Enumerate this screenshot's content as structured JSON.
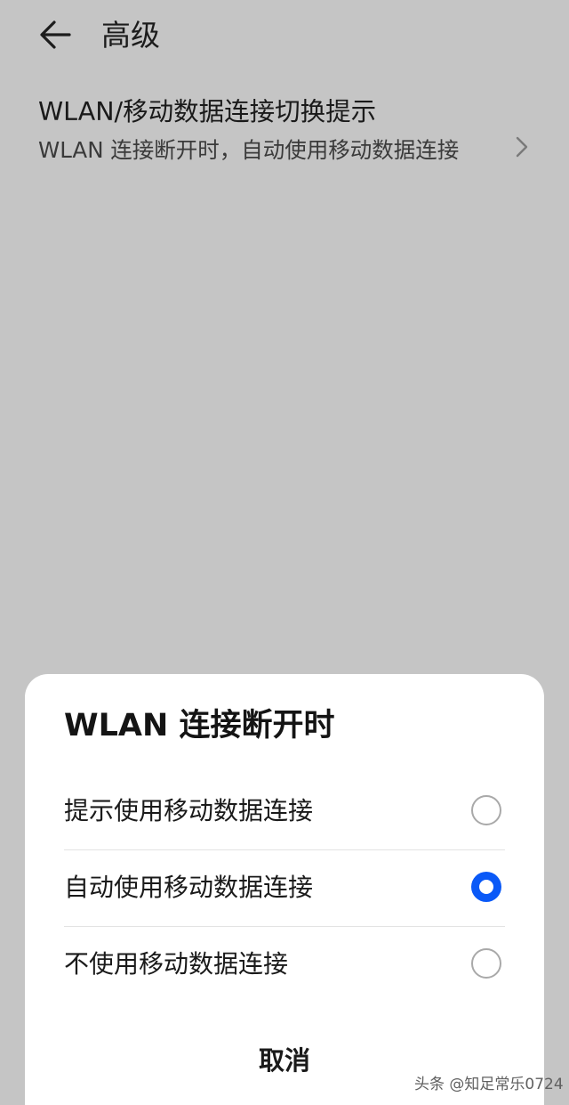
{
  "header": {
    "back_icon": "arrow-left-icon",
    "title": "高级"
  },
  "setting": {
    "title": "WLAN/移动数据连接切换提示",
    "description": "WLAN 连接断开时，自动使用移动数据连接",
    "chevron_icon": "chevron-right-icon"
  },
  "dialog": {
    "title": "WLAN 连接断开时",
    "options": [
      {
        "label": "提示使用移动数据连接",
        "selected": false
      },
      {
        "label": "自动使用移动数据连接",
        "selected": true
      },
      {
        "label": "不使用移动数据连接",
        "selected": false
      }
    ],
    "cancel_label": "取消"
  },
  "watermark": "头条 @知足常乐0724",
  "colors": {
    "background": "#c5c5c5",
    "sheet": "#ffffff",
    "accent": "#0a59f7"
  }
}
